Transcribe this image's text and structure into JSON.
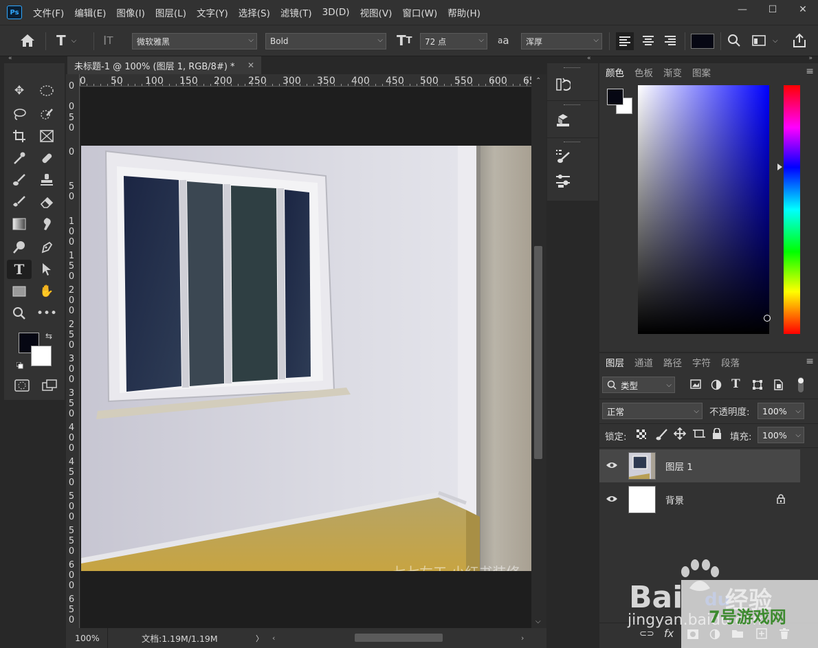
{
  "app": {
    "logo": "Ps",
    "menu": [
      "文件(F)",
      "编辑(E)",
      "图像(I)",
      "图层(L)",
      "文字(Y)",
      "选择(S)",
      "滤镜(T)",
      "3D(D)",
      "视图(V)",
      "窗口(W)",
      "帮助(H)"
    ],
    "window_controls": {
      "minimize": "—",
      "maximize": "☐",
      "close": "✕"
    }
  },
  "options": {
    "font_family": "微软雅黑",
    "font_style": "Bold",
    "font_size": "72 点",
    "aa_label": "a",
    "aa_sub": "a",
    "anti_alias": "浑厚",
    "text_color": "#060713"
  },
  "document": {
    "tab_title": "未标题-1 @ 100% (图层 1, RGB/8#) *",
    "close": "✕",
    "ruler_h": [
      "0",
      "50",
      "100",
      "150",
      "200",
      "250",
      "300",
      "350",
      "400",
      "450",
      "500",
      "550",
      "600",
      "65"
    ],
    "ruler_v": [
      "0",
      "0",
      "5",
      "0",
      "0",
      "5",
      "0",
      "1",
      "0",
      "0",
      "1",
      "5",
      "0",
      "2",
      "0",
      "0",
      "2",
      "5",
      "0",
      "3",
      "0",
      "0",
      "3",
      "5",
      "0",
      "4",
      "0",
      "0",
      "4",
      "5",
      "0",
      "5",
      "0",
      "0",
      "5",
      "5",
      "0",
      "6",
      "0",
      "0",
      "6",
      "5",
      "0"
    ],
    "zoom": "100%",
    "doc_size": "文档:1.19M/1.19M",
    "status_arrow": "〉",
    "photo_caption": "七七左工·小红书装修"
  },
  "colors": {
    "foreground": "#060713",
    "background": "#ffffff",
    "picker_hue": "#0000ff"
  },
  "color_panel": {
    "tabs": [
      "颜色",
      "色板",
      "渐变",
      "图案"
    ],
    "active_tab": "颜色"
  },
  "layers_panel": {
    "tabs": [
      "图层",
      "通道",
      "路径",
      "字符",
      "段落"
    ],
    "active_tab": "图层",
    "filter_kind": "类型",
    "blend_mode": "正常",
    "opacity_label": "不透明度:",
    "opacity": "100%",
    "lock_label": "锁定:",
    "fill_label": "填充:",
    "fill": "100%",
    "layers": [
      {
        "name": "图层 1",
        "visible": true,
        "selected": true
      },
      {
        "name": "背景",
        "visible": true,
        "locked": true
      }
    ],
    "footer_fx": "fx"
  },
  "watermark": {
    "text1": "Bai",
    "text2": "du",
    "text3": "经验",
    "url": "jingyan.baidu.com",
    "logo_text": "7号游戏网"
  }
}
